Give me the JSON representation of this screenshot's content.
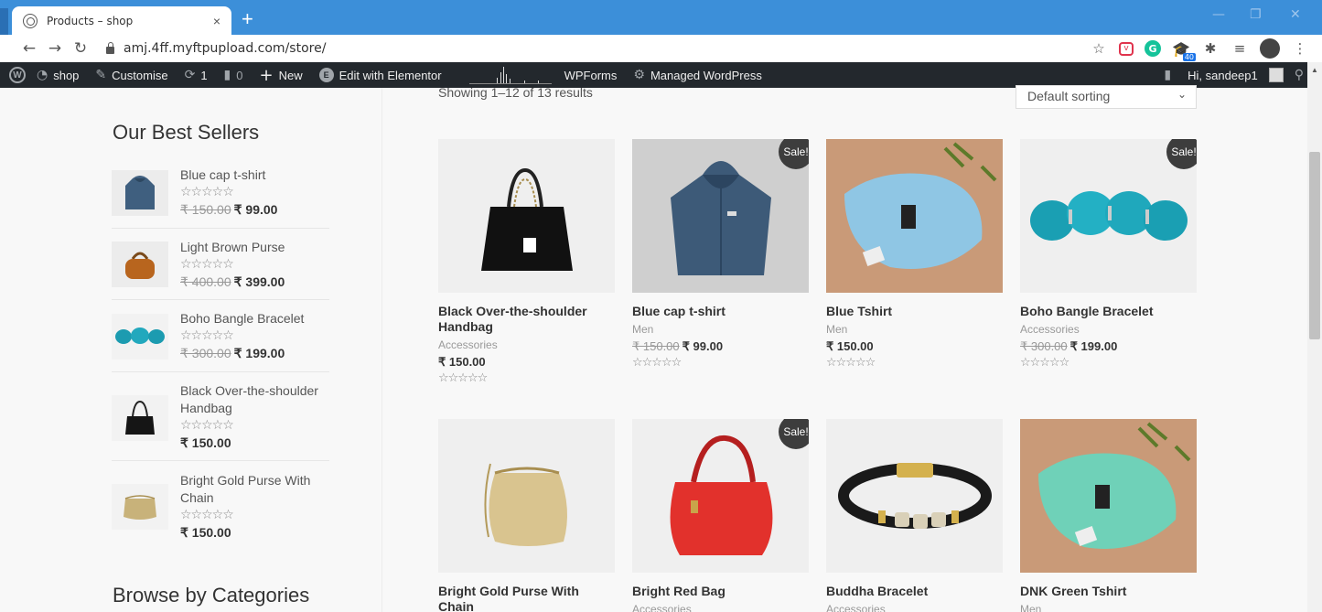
{
  "browser": {
    "tab_title": "Products – shop",
    "tab_close": "×",
    "new_tab": "+",
    "url": "amj.4ff.myftpupload.com/store/",
    "ext_badge": "40"
  },
  "adminbar": {
    "site": "shop",
    "customise": "Customise",
    "updates_count": "1",
    "comments_count": "0",
    "new": "New",
    "elementor": "Edit with Elementor",
    "wpforms": "WPForms",
    "managed": "Managed WordPress",
    "greeting": "Hi, sandeep1"
  },
  "sidebar": {
    "best_sellers_title": "Our Best Sellers",
    "categories_title": "Browse by Categories",
    "items": [
      {
        "name": "Blue cap t-shirt",
        "stars": "☆☆☆☆☆",
        "old_price": "₹ 150.00",
        "price": "₹ 99.00"
      },
      {
        "name": "Light Brown Purse",
        "stars": "☆☆☆☆☆",
        "old_price": "₹ 400.00",
        "price": "₹ 399.00"
      },
      {
        "name": "Boho Bangle Bracelet",
        "stars": "☆☆☆☆☆",
        "old_price": "₹ 300.00",
        "price": "₹ 199.00"
      },
      {
        "name": "Black Over-the-shoulder Handbag",
        "stars": "☆☆☆☆☆",
        "old_price": "",
        "price": "₹ 150.00"
      },
      {
        "name": "Bright Gold Purse With Chain",
        "stars": "☆☆☆☆☆",
        "old_price": "",
        "price": "₹ 150.00"
      }
    ]
  },
  "shop": {
    "result_count": "Showing 1–12 of 13 results",
    "sorting": "Default sorting",
    "sale_label": "Sale!",
    "products": [
      {
        "title": "Black Over-the-shoulder Handbag",
        "category": "Accessories",
        "old_price": "",
        "price": "₹ 150.00",
        "stars": "☆☆☆☆☆"
      },
      {
        "title": "Blue cap t-shirt",
        "category": "Men",
        "old_price": "₹ 150.00",
        "price": "₹ 99.00",
        "stars": "☆☆☆☆☆"
      },
      {
        "title": "Blue Tshirt",
        "category": "Men",
        "old_price": "",
        "price": "₹ 150.00",
        "stars": "☆☆☆☆☆"
      },
      {
        "title": "Boho Bangle Bracelet",
        "category": "Accessories",
        "old_price": "₹ 300.00",
        "price": "₹ 199.00",
        "stars": "☆☆☆☆☆"
      },
      {
        "title": "Bright Gold Purse With Chain",
        "category": "",
        "old_price": "",
        "price": "",
        "stars": ""
      },
      {
        "title": "Bright Red Bag",
        "category": "Accessories",
        "old_price": "",
        "price": "",
        "stars": ""
      },
      {
        "title": "Buddha Bracelet",
        "category": "Accessories",
        "old_price": "",
        "price": "",
        "stars": ""
      },
      {
        "title": "DNK Green Tshirt",
        "category": "Men",
        "old_price": "",
        "price": "",
        "stars": ""
      }
    ]
  },
  "colors": {
    "tabstrip": "#3c8fd9",
    "adminbar": "#23282d",
    "sale_badge": "#3d3d3d"
  }
}
